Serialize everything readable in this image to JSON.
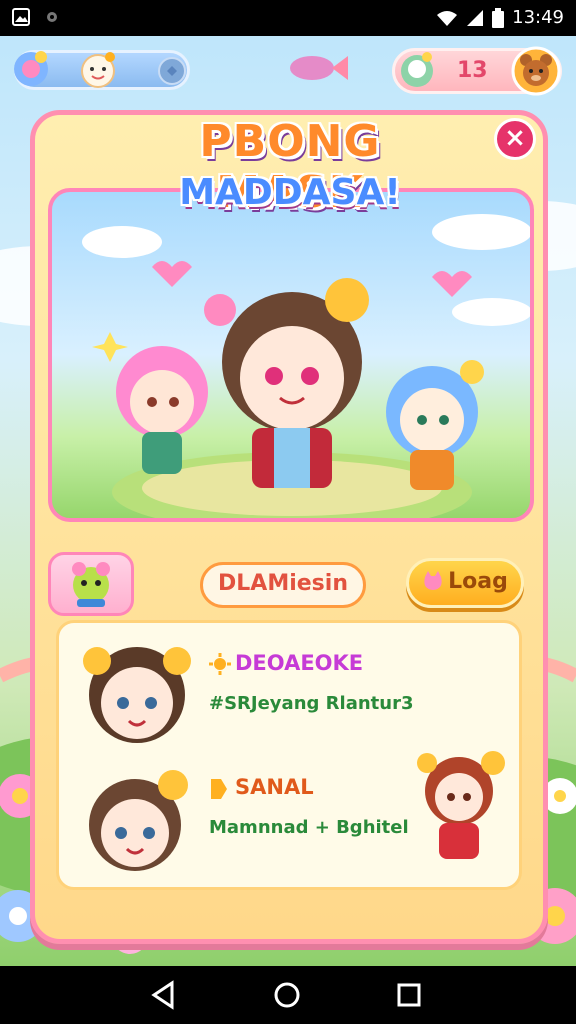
{
  "status_bar": {
    "time": "13:49",
    "icons": [
      "image-notification-icon",
      "settings-notification-icon",
      "wifi-icon",
      "signal-icon",
      "battery-icon"
    ]
  },
  "hud": {
    "left_icons": [
      "flower-icon",
      "smiley-avatar-icon",
      "gem-icon"
    ],
    "currency_count": "13",
    "right_icons": [
      "pet-avatar-icon",
      "bear-profile-icon"
    ]
  },
  "panel": {
    "title_line1": "PBONG MASK",
    "title_line2": "MADDASA!",
    "close_label": "×"
  },
  "tabs": {
    "name_label": "DLAMiesin",
    "log_label": "Loag"
  },
  "list": {
    "items": [
      {
        "title": "DEOAEOKE",
        "subtitle": "#SRJeyang Rlantur3",
        "title_color": "#c63bd6"
      },
      {
        "title": "SANAL",
        "subtitle": "Mamnnad + Bghitel",
        "title_color": "#e05a1b"
      }
    ]
  },
  "colors": {
    "panel_border": "#ff8fb0",
    "accent_orange": "#ffae20",
    "close_red": "#e6336a"
  }
}
